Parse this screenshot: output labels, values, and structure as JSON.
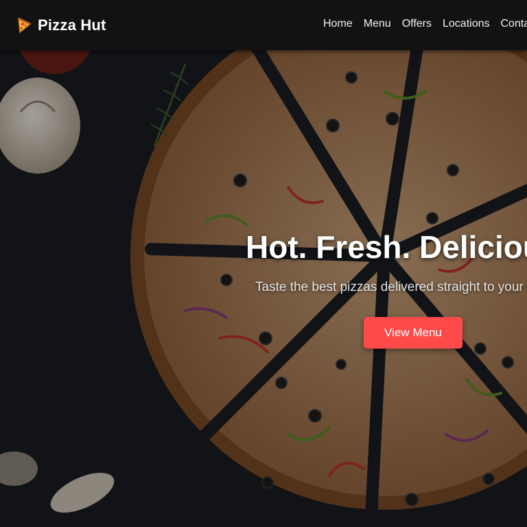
{
  "brand": {
    "name": "Pizza Hut",
    "icon": "pizza-slice-icon"
  },
  "nav": {
    "items": [
      {
        "label": "Home"
      },
      {
        "label": "Menu"
      },
      {
        "label": "Offers"
      },
      {
        "label": "Locations"
      },
      {
        "label": "Contact"
      }
    ]
  },
  "hero": {
    "title": "Hot. Fresh. Delicious.",
    "subtitle": "Taste the best pizzas delivered straight to your door.",
    "cta_label": "View Menu",
    "background": "pizza-photo"
  },
  "colors": {
    "accent": "#ff4a4a",
    "navbar": "#121212",
    "background": "#16191e"
  }
}
